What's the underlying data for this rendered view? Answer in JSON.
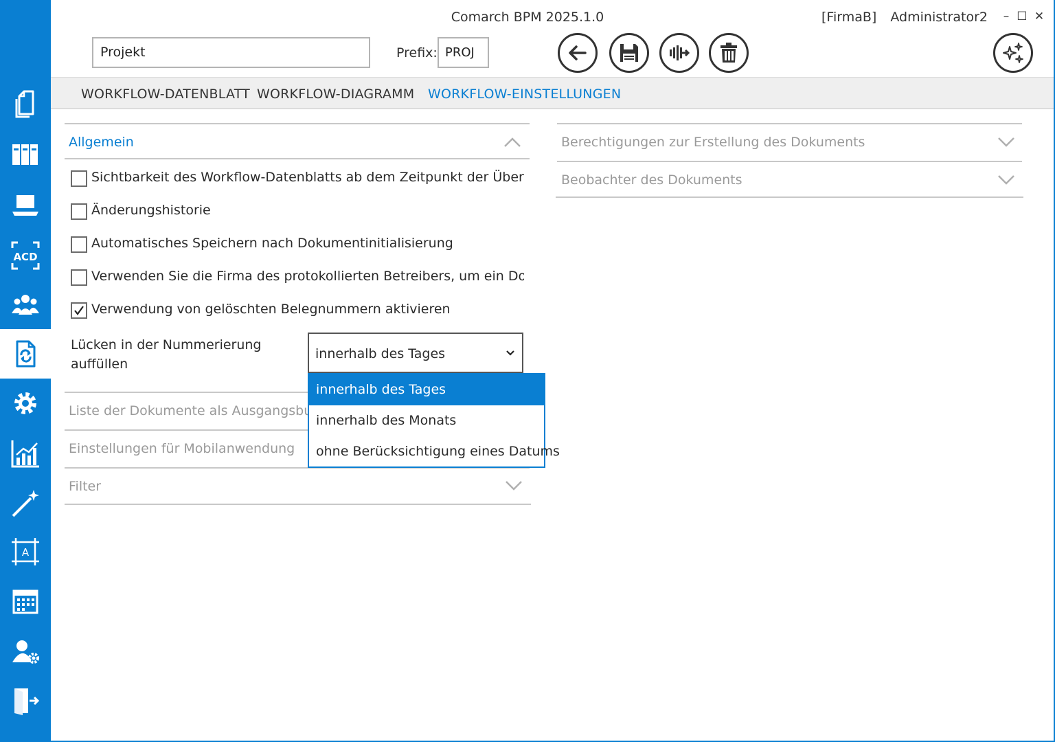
{
  "app": {
    "title": "Comarch BPM 2025.1.0",
    "company": "[FirmaB]",
    "user": "Administrator2",
    "controls": {
      "minimize": "–",
      "maximize": "☐",
      "close": "✕"
    }
  },
  "header": {
    "name_value": "Projekt",
    "prefix_label": "Prefix:",
    "prefix_value": "PROJ",
    "toolbar": [
      {
        "name": "back-button",
        "icon": "arrow-left-icon"
      },
      {
        "name": "save-button",
        "icon": "floppy-disk-icon"
      },
      {
        "name": "workflow-actions-button",
        "icon": "workflow-branch-icon"
      },
      {
        "name": "delete-button",
        "icon": "trash-icon"
      }
    ],
    "assistant_icon": "sparkles-icon"
  },
  "sidebar": {
    "items": [
      {
        "icon": "documents-icon",
        "active": false
      },
      {
        "icon": "binders-icon",
        "active": false
      },
      {
        "icon": "laptop-icon",
        "active": false
      },
      {
        "icon": "ocr-acd-icon",
        "active": false
      },
      {
        "icon": "users-group-icon",
        "active": false
      },
      {
        "icon": "document-workflow-icon",
        "active": true
      },
      {
        "icon": "gear-icon",
        "active": false
      },
      {
        "icon": "bar-chart-icon",
        "active": false
      },
      {
        "icon": "magic-wand-icon",
        "active": false
      },
      {
        "icon": "form-designer-icon",
        "active": false
      },
      {
        "icon": "calendar-icon",
        "active": false
      },
      {
        "icon": "user-settings-icon",
        "active": false
      },
      {
        "icon": "logout-door-icon",
        "active": false
      }
    ]
  },
  "tabs": [
    {
      "label": "WORKFLOW-DATENBLATT",
      "active": false
    },
    {
      "label": "WORKFLOW-DIAGRAMM",
      "active": false
    },
    {
      "label": "WORKFLOW-EINSTELLUNGEN",
      "active": true
    }
  ],
  "left_panel": {
    "general": {
      "title": "Allgemein",
      "expanded": true,
      "checkboxes": [
        {
          "label": "Sichtbarkeit des Workflow-Datenblatts ab dem Zeitpunkt der Übergabe",
          "checked": false
        },
        {
          "label": "Änderungshistorie",
          "checked": false
        },
        {
          "label": "Automatisches Speichern nach Dokumentinitialisierung",
          "checked": false
        },
        {
          "label": "Verwenden Sie die Firma des protokollierten Betreibers, um ein Dokument",
          "checked": false
        },
        {
          "label": "Verwendung von gelöschten Belegnummern aktivieren",
          "checked": true
        }
      ],
      "fill_gaps_label": "Lücken in der Nummerierung auffüllen",
      "fill_gaps_value": "innerhalb des Tages",
      "fill_gaps_options": [
        {
          "label": "innerhalb des Tages",
          "selected": true
        },
        {
          "label": "innerhalb des Monats",
          "selected": false
        },
        {
          "label": "ohne Berücksichtigung eines Datums",
          "selected": false
        }
      ]
    },
    "sections": [
      {
        "title": "Liste der Dokumente als Ausgangsbuch"
      },
      {
        "title": "Einstellungen für Mobilanwendung"
      },
      {
        "title": "Filter"
      }
    ]
  },
  "right_panel": {
    "sections": [
      {
        "title": "Berechtigungen zur Erstellung des Dokuments"
      },
      {
        "title": "Beobachter des Dokuments"
      }
    ]
  },
  "colors": {
    "accent": "#0a7fd2",
    "sidebar": "#0a7fd2",
    "muted_text": "#9a9a9a",
    "tabbar_bg": "#efefef"
  }
}
